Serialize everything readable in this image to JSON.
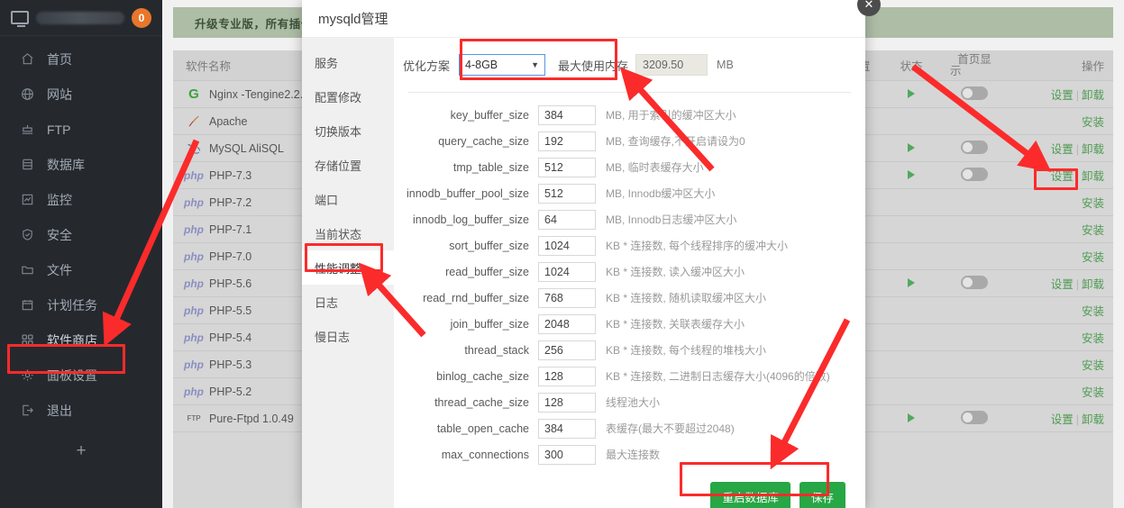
{
  "sidebar": {
    "badge": "0",
    "icons": {
      "monitor": "monitor-icon",
      "add": "plus-icon"
    },
    "add_label": "+",
    "items": [
      {
        "label": "首页",
        "icon": "home-icon"
      },
      {
        "label": "网站",
        "icon": "globe-icon"
      },
      {
        "label": "FTP",
        "icon": "ftp-icon"
      },
      {
        "label": "数据库",
        "icon": "database-icon"
      },
      {
        "label": "监控",
        "icon": "chart-icon"
      },
      {
        "label": "安全",
        "icon": "shield-icon"
      },
      {
        "label": "文件",
        "icon": "folder-icon"
      },
      {
        "label": "计划任务",
        "icon": "calendar-icon"
      },
      {
        "label": "软件商店",
        "icon": "grid-icon"
      },
      {
        "label": "面板设置",
        "icon": "gear-icon"
      },
      {
        "label": "退出",
        "icon": "logout-icon"
      }
    ]
  },
  "page": {
    "promo": "升级专业版，所有插件，",
    "table": {
      "headers": {
        "name": "软件名称",
        "version": "",
        "position": "位置",
        "status": "状态",
        "home": "首页显\n示",
        "home_line1": "首页显",
        "home_line2": "示",
        "action": "操作"
      },
      "action_settings": "设置",
      "action_uninstall": "卸载",
      "action_install": "安装",
      "separator": "|",
      "rows": [
        {
          "name": "Nginx -Tengine2.2.",
          "icon": "nginx-icon",
          "installed": true
        },
        {
          "name": "Apache",
          "icon": "apache-icon",
          "installed": false
        },
        {
          "name": "MySQL AliSQL",
          "icon": "mysql-icon",
          "installed": true
        },
        {
          "name": "PHP-7.3",
          "icon": "php-icon",
          "installed": true
        },
        {
          "name": "PHP-7.2",
          "icon": "php-icon",
          "installed": false
        },
        {
          "name": "PHP-7.1",
          "icon": "php-icon",
          "installed": false
        },
        {
          "name": "PHP-7.0",
          "icon": "php-icon",
          "installed": false
        },
        {
          "name": "PHP-5.6",
          "icon": "php-icon",
          "installed": true
        },
        {
          "name": "PHP-5.5",
          "icon": "php-icon",
          "installed": false
        },
        {
          "name": "PHP-5.4",
          "icon": "php-icon",
          "installed": false
        },
        {
          "name": "PHP-5.3",
          "icon": "php-icon",
          "installed": false
        },
        {
          "name": "PHP-5.2",
          "icon": "php-icon",
          "installed": false
        },
        {
          "name": "Pure-Ftpd 1.0.49",
          "icon": "ftp-icon",
          "installed": true
        }
      ]
    }
  },
  "modal": {
    "title": "mysqld管理",
    "close_icon": "close-icon",
    "close_glyph": "✕",
    "tabs": [
      {
        "label": "服务",
        "active": false
      },
      {
        "label": "配置修改",
        "active": false
      },
      {
        "label": "切换版本",
        "active": false
      },
      {
        "label": "存储位置",
        "active": false
      },
      {
        "label": "端口",
        "active": false
      },
      {
        "label": "当前状态",
        "active": false
      },
      {
        "label": "性能调整",
        "active": true
      },
      {
        "label": "日志",
        "active": false
      },
      {
        "label": "慢日志",
        "active": false
      }
    ],
    "scheme": {
      "label": "优化方案",
      "value": "4-8GB",
      "caret": "▼",
      "memory_label": "最大使用内存",
      "memory_value": "3209.50",
      "memory_unit": "MB"
    },
    "params": [
      {
        "name": "key_buffer_size",
        "value": "384",
        "desc": "MB, 用于索引的缓冲区大小"
      },
      {
        "name": "query_cache_size",
        "value": "192",
        "desc": "MB, 查询缓存,不开启请设为0"
      },
      {
        "name": "tmp_table_size",
        "value": "512",
        "desc": "MB, 临时表缓存大小"
      },
      {
        "name": "innodb_buffer_pool_size",
        "value": "512",
        "desc": "MB, Innodb缓冲区大小"
      },
      {
        "name": "innodb_log_buffer_size",
        "value": "64",
        "desc": "MB, Innodb日志缓冲区大小"
      },
      {
        "name": "sort_buffer_size",
        "value": "1024",
        "desc": "KB * 连接数, 每个线程排序的缓冲大小"
      },
      {
        "name": "read_buffer_size",
        "value": "1024",
        "desc": "KB * 连接数, 读入缓冲区大小"
      },
      {
        "name": "read_rnd_buffer_size",
        "value": "768",
        "desc": "KB * 连接数, 随机读取缓冲区大小"
      },
      {
        "name": "join_buffer_size",
        "value": "2048",
        "desc": "KB * 连接数, 关联表缓存大小"
      },
      {
        "name": "thread_stack",
        "value": "256",
        "desc": "KB * 连接数, 每个线程的堆栈大小"
      },
      {
        "name": "binlog_cache_size",
        "value": "128",
        "desc": "KB * 连接数, 二进制日志缓存大小(4096的倍数)"
      },
      {
        "name": "thread_cache_size",
        "value": "128",
        "desc": "线程池大小"
      },
      {
        "name": "table_open_cache",
        "value": "384",
        "desc": "表缓存(最大不要超过2048)"
      },
      {
        "name": "max_connections",
        "value": "300",
        "desc": "最大连接数"
      }
    ],
    "buttons": {
      "restart": "重启数据库",
      "save": "保存"
    }
  },
  "annotations": {
    "highlight_color": "#fb2b2b",
    "arrow_color": "#fb2b2b",
    "boxes": [
      {
        "name": "software-store-highlight"
      },
      {
        "name": "performance-tab-highlight"
      },
      {
        "name": "scheme-select-highlight"
      },
      {
        "name": "settings-link-highlight"
      },
      {
        "name": "buttons-highlight"
      }
    ]
  }
}
